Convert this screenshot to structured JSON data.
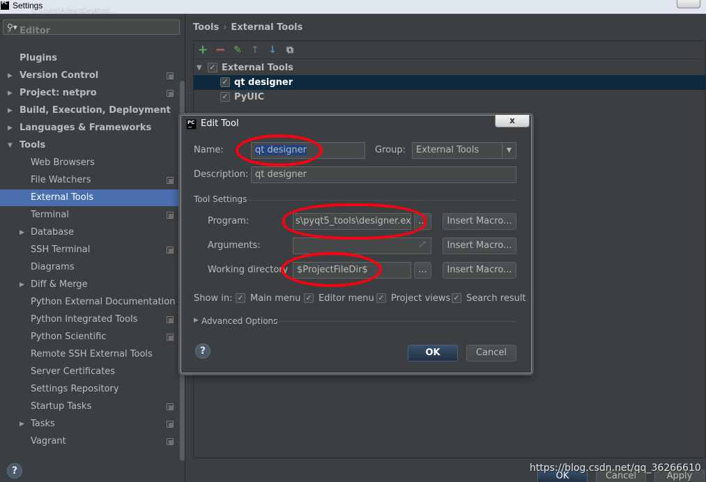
{
  "window": {
    "app_icon": "PC",
    "title": "Settings",
    "faint_path": "C:\\Users\\Admin\\Desktop\\...",
    "close_icon": "close-icon"
  },
  "search": {
    "icon": "search-icon",
    "placeholder": ""
  },
  "sidebar": {
    "items": [
      {
        "label": "Editor",
        "bold": true,
        "arrow": "▸",
        "proj": false
      },
      {
        "label": "Plugins",
        "bold": true,
        "arrow": "",
        "proj": false
      },
      {
        "label": "Version Control",
        "bold": true,
        "arrow": "▶",
        "proj": true
      },
      {
        "label": "Project: netpro",
        "bold": true,
        "arrow": "▶",
        "proj": true
      },
      {
        "label": "Build, Execution, Deployment",
        "bold": true,
        "arrow": "▶",
        "proj": false
      },
      {
        "label": "Languages & Frameworks",
        "bold": true,
        "arrow": "▶",
        "proj": false
      },
      {
        "label": "Tools",
        "bold": true,
        "arrow": "▼",
        "proj": false
      },
      {
        "label": "Web Browsers",
        "bold": false,
        "arrow": "",
        "proj": false
      },
      {
        "label": "File Watchers",
        "bold": false,
        "arrow": "",
        "proj": true
      },
      {
        "label": "External Tools",
        "bold": false,
        "arrow": "",
        "proj": false,
        "selected": true
      },
      {
        "label": "Terminal",
        "bold": false,
        "arrow": "",
        "proj": true
      },
      {
        "label": "Database",
        "bold": false,
        "arrow": "▶",
        "proj": false
      },
      {
        "label": "SSH Terminal",
        "bold": false,
        "arrow": "",
        "proj": true
      },
      {
        "label": "Diagrams",
        "bold": false,
        "arrow": "",
        "proj": false
      },
      {
        "label": "Diff & Merge",
        "bold": false,
        "arrow": "▶",
        "proj": false
      },
      {
        "label": "Python External Documentation",
        "bold": false,
        "arrow": "",
        "proj": false
      },
      {
        "label": "Python Integrated Tools",
        "bold": false,
        "arrow": "",
        "proj": true
      },
      {
        "label": "Python Scientific",
        "bold": false,
        "arrow": "",
        "proj": true
      },
      {
        "label": "Remote SSH External Tools",
        "bold": false,
        "arrow": "",
        "proj": false
      },
      {
        "label": "Server Certificates",
        "bold": false,
        "arrow": "",
        "proj": false
      },
      {
        "label": "Settings Repository",
        "bold": false,
        "arrow": "",
        "proj": false
      },
      {
        "label": "Startup Tasks",
        "bold": false,
        "arrow": "",
        "proj": true
      },
      {
        "label": "Tasks",
        "bold": false,
        "arrow": "▶",
        "proj": true
      },
      {
        "label": "Vagrant",
        "bold": false,
        "arrow": "",
        "proj": true
      }
    ],
    "help": "?"
  },
  "breadcrumb": {
    "first": "Tools",
    "separator": "›",
    "second": "External Tools"
  },
  "toolbar": {
    "add": "+",
    "remove": "−",
    "edit": "✎",
    "up": "↑",
    "down": "↓",
    "copy": "⧉"
  },
  "tools_tree": {
    "group": {
      "label": "External Tools",
      "checked": true
    },
    "items": [
      {
        "label": "qt designer",
        "checked": true
      },
      {
        "label": "PyUIC",
        "checked": true
      }
    ]
  },
  "dialog": {
    "app_icon": "PC",
    "title": "Edit Tool",
    "close": "x",
    "name_label": "Name:",
    "name_value": "qt designer",
    "group_label": "Group:",
    "group_value": "External Tools",
    "description_label": "Description:",
    "description_value": "qt designer",
    "tool_settings": "Tool Settings",
    "program_label": "Program:",
    "program_value": "s\\pyqt5_tools\\designer.exe",
    "arguments_label": "Arguments:",
    "arguments_value": "",
    "workdir_label": "Working directory",
    "workdir_value": "$ProjectFileDir$",
    "browse": "...",
    "insert_macro": "Insert Macro...",
    "show_in_label": "Show in:",
    "show_in": [
      {
        "label": "Main menu",
        "checked": true
      },
      {
        "label": "Editor menu",
        "checked": true
      },
      {
        "label": "Project views",
        "checked": true
      },
      {
        "label": "Search result",
        "checked": true
      }
    ],
    "advanced": "Advanced Options",
    "ok": "OK",
    "cancel": "Cancel",
    "help": "?"
  },
  "bottom": {
    "ok": "OK",
    "cancel": "Cancel",
    "apply": "Apply"
  },
  "watermark": "https://blog.csdn.net/qq_36266610"
}
